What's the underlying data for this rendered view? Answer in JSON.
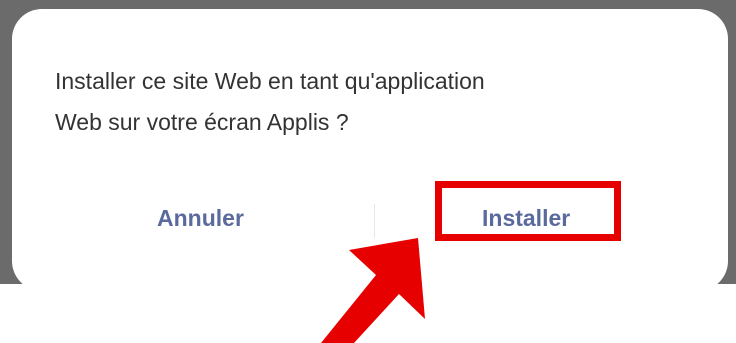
{
  "dialog": {
    "message_line1": "Installer ce site Web en tant qu'application",
    "message_line2": "Web sur votre écran Applis ?",
    "cancel_label": "Annuler",
    "install_label": "Installer"
  },
  "annotation": {
    "highlight_color": "#e60000",
    "arrow_icon": "red-arrow-pointing-up-right"
  },
  "colors": {
    "button_text": "#5b6a9c",
    "message_text": "#333333",
    "backdrop": "#6b6b6b"
  }
}
